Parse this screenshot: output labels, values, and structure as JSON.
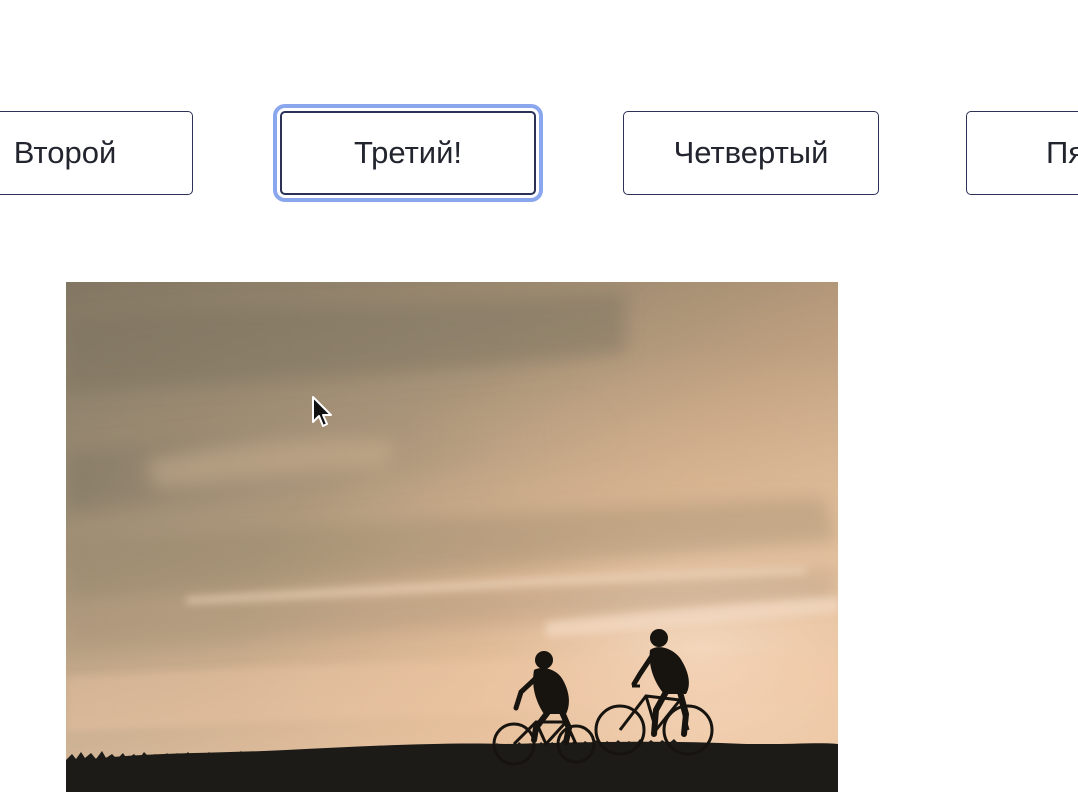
{
  "buttons": {
    "second": "Второй",
    "third": "Третий!",
    "fourth": "Четвертый",
    "fifth": "Пятый"
  },
  "photo": {
    "subject": "two-cyclists-silhouette-at-sunset"
  },
  "colors": {
    "button_border": "#2b3157",
    "focus_ring": "#8aa7ee",
    "sky_top": "#8f826c",
    "sky_glow": "#e8bf98",
    "ground": "#1c1b18"
  }
}
